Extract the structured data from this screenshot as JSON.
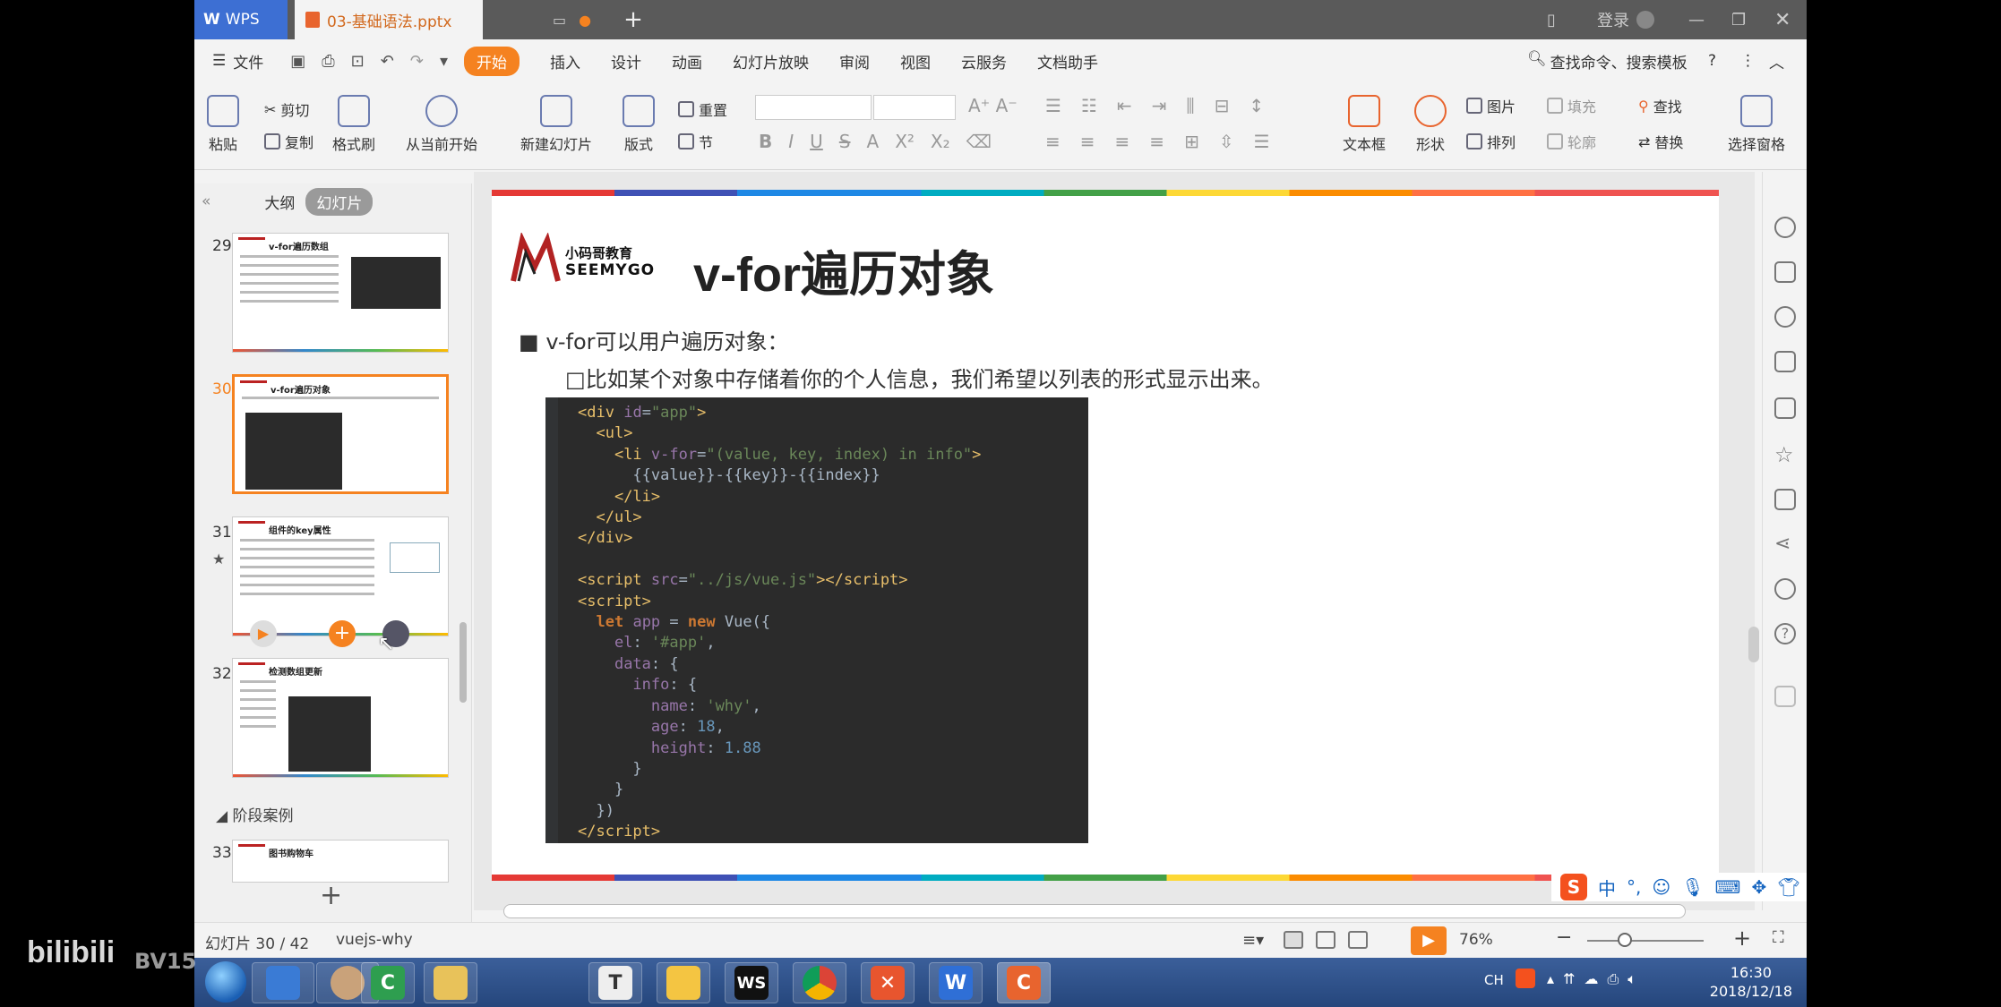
{
  "titlebar": {
    "app_tab": "WPS",
    "file_tab": "03-基础语法.pptx",
    "login": "登录"
  },
  "menubar": {
    "file": "文件",
    "items": [
      "开始",
      "插入",
      "设计",
      "动画",
      "幻灯片放映",
      "审阅",
      "视图",
      "云服务",
      "文档助手"
    ],
    "search": "查找命令、搜索模板"
  },
  "ribbon": {
    "paste": "粘贴",
    "cut": "剪切",
    "copy": "复制",
    "format_painter": "格式刷",
    "from_current": "从当前开始",
    "new_slide": "新建幻灯片",
    "layout": "版式",
    "reset": "重置",
    "section": "节",
    "image": "图片",
    "fill": "填充",
    "textbox": "文本框",
    "shape": "形状",
    "arrange": "排列",
    "outline": "轮廓",
    "find": "查找",
    "replace": "替换",
    "select_pane": "选择窗格"
  },
  "leftpanel": {
    "tab_outline": "大纲",
    "tab_slides": "幻灯片",
    "section_label": "阶段案例",
    "slides": [
      {
        "num": "29",
        "title": "v-for遍历数组"
      },
      {
        "num": "30",
        "title": "v-for遍历对象"
      },
      {
        "num": "31",
        "title": "组件的key属性"
      },
      {
        "num": "32",
        "title": "检测数组更新"
      },
      {
        "num": "33",
        "title": "图书购物车"
      }
    ]
  },
  "slide": {
    "logo_cn": "小码哥教育",
    "logo_en": "SEEMYGO",
    "title": "v-for遍历对象",
    "bullet1": "v-for可以用户遍历对象：",
    "bullet2": "比如某个对象中存储着你的个人信息，我们希望以列表的形式显示出来。"
  },
  "statusbar": {
    "slide_counter": "幻灯片 30 / 42",
    "theme": "vuejs-why",
    "zoom": "76%"
  },
  "ime": {
    "label": "中"
  },
  "taskbar": {
    "tray_ch": "CH",
    "time": "16:30",
    "date": "2018/12/18"
  },
  "watermark": {
    "site": "bilibili",
    "id": "BV15"
  },
  "colors": {
    "accent": "#f58220",
    "wps_blue": "#3d6fd3"
  }
}
